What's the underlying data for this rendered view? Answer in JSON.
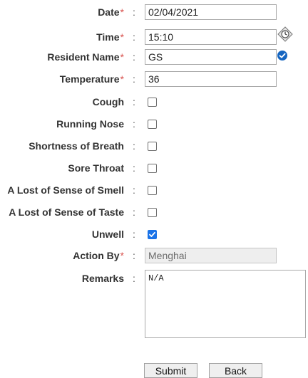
{
  "fields": {
    "date": {
      "label": "Date",
      "value": "02/04/2021"
    },
    "time": {
      "label": "Time",
      "value": "15:10"
    },
    "resident": {
      "label": "Resident Name",
      "value": "GS"
    },
    "temperature": {
      "label": "Temperature",
      "value": "36"
    },
    "action_by": {
      "label": "Action By",
      "value": "Menghai"
    },
    "remarks": {
      "label": "Remarks",
      "value": "N/A"
    }
  },
  "symptoms": [
    {
      "label": "Cough",
      "checked": false
    },
    {
      "label": "Running Nose",
      "checked": false
    },
    {
      "label": "Shortness of Breath",
      "checked": false
    },
    {
      "label": "Sore Throat",
      "checked": false
    },
    {
      "label": "A Lost of Sense of Smell",
      "checked": false
    },
    {
      "label": "A Lost of Sense of Taste",
      "checked": false
    },
    {
      "label": "Unwell",
      "checked": true
    }
  ],
  "required_marker": "*",
  "colon": ":",
  "buttons": {
    "submit": "Submit",
    "back": "Back"
  },
  "icons": {
    "time_picker": "clock-picker-icon",
    "verified": "check-circle-icon"
  },
  "colors": {
    "required": "#d9534f",
    "accent": "#1a73e8",
    "verified": "#1565c0"
  }
}
